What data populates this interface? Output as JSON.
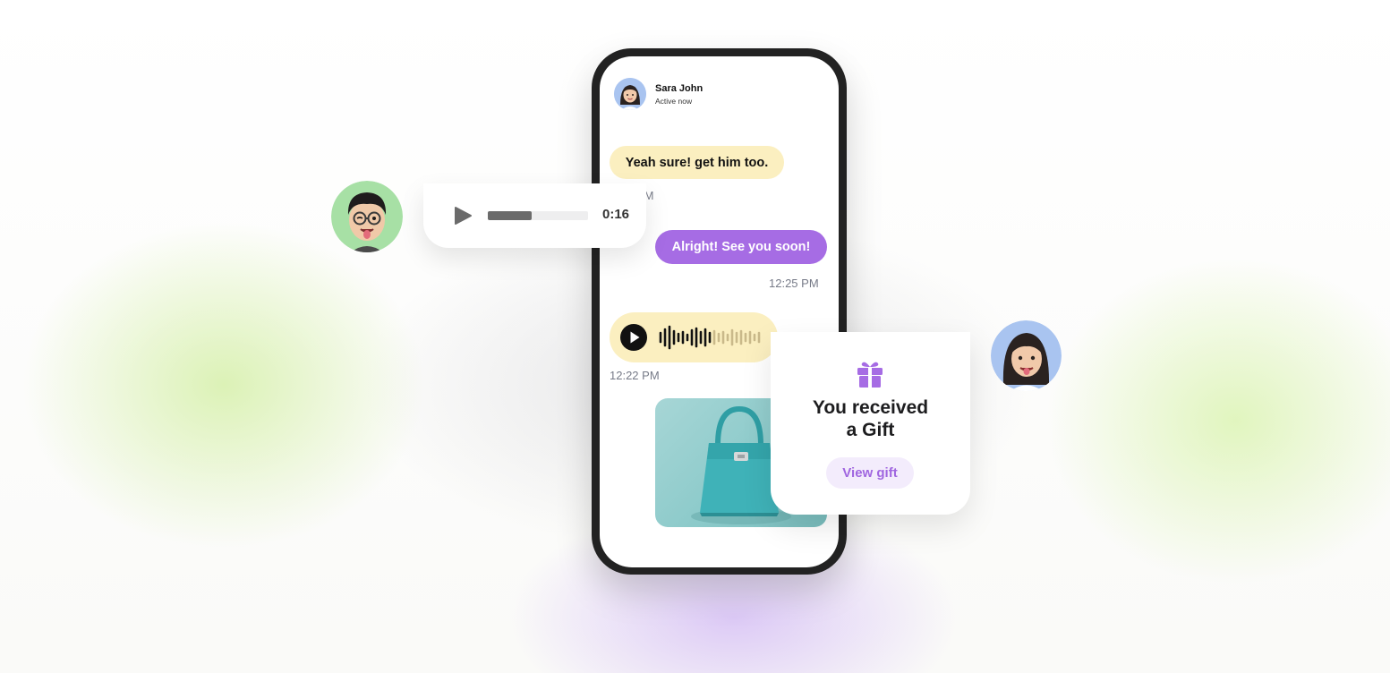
{
  "chat": {
    "contact_name": "Sara John",
    "contact_status": "Active now",
    "messages": [
      {
        "text": "Yeah sure! get him too.",
        "side": "incoming"
      },
      {
        "time": "12:?? PM"
      },
      {
        "text": "Alright! See you soon!",
        "side": "outgoing"
      },
      {
        "time": "12:25 PM"
      },
      {
        "type": "voice",
        "side": "incoming"
      },
      {
        "time": "12:22 PM"
      },
      {
        "type": "image",
        "side": "outgoing"
      }
    ],
    "partial_time_text": "PM",
    "time_2": "12:25 PM",
    "time_3": "12:22 PM",
    "msg_1": "Yeah sure! get him too.",
    "msg_2": "Alright! See you soon!"
  },
  "voice_card": {
    "duration": "0:16",
    "progress": 0.44
  },
  "gift_card": {
    "title_line1": "You received",
    "title_line2": "a Gift",
    "button_label": "View gift"
  },
  "colors": {
    "accent_purple": "#a66ce4",
    "bubble_yellow": "#fbefc0",
    "gift_button_bg": "#f3ecfc"
  },
  "icons": {
    "voice_play": "play-icon",
    "waveform_play": "play-icon",
    "gift": "gift-icon"
  }
}
